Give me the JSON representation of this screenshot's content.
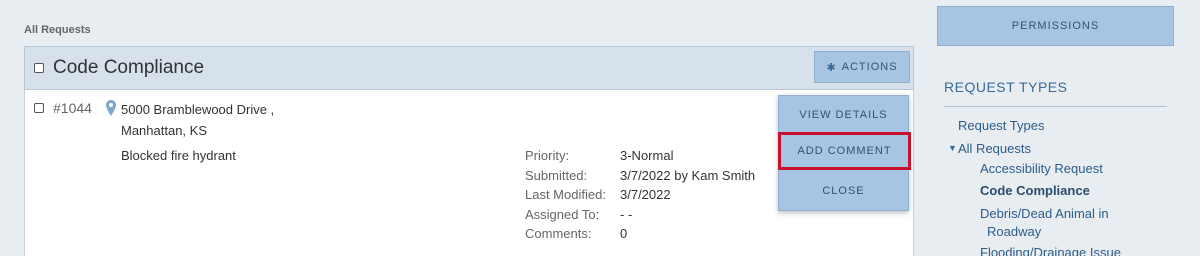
{
  "breadcrumb": "All Requests",
  "group": {
    "title": "Code Compliance",
    "actions_label": "ACTIONS"
  },
  "request": {
    "number": "#1044",
    "address_line1": "5000 Bramblewood Drive ,",
    "address_line2": "Manhattan, KS",
    "description": "Blocked fire hydrant",
    "meta": [
      {
        "label": "Priority:",
        "value": "3-Normal"
      },
      {
        "label": "Submitted:",
        "value": "3/7/2022 by Kam Smith"
      },
      {
        "label": "Last Modified:",
        "value": "3/7/2022"
      },
      {
        "label": "Assigned To:",
        "value": "- -"
      },
      {
        "label": "Comments:",
        "value": "0"
      }
    ]
  },
  "actions_menu": {
    "items": [
      "VIEW DETAILS",
      "ADD COMMENT",
      "CLOSE"
    ],
    "highlighted": "ADD COMMENT"
  },
  "sidebar": {
    "permissions_label": "PERMISSIONS",
    "heading": "REQUEST TYPES",
    "items": [
      "Request Types",
      "All Requests",
      "Accessibility Request",
      "Code Compliance",
      "Debris/Dead Animal in",
      "Roadway",
      "Flooding/Drainage Issue"
    ],
    "current": "Code Compliance"
  },
  "colors": {
    "accent": "#a7c4e2",
    "highlight_border": "#c8102e",
    "link": "#2e5c8a"
  },
  "icons": [
    "gear-icon",
    "location-pin-icon",
    "expand-triangle-icon"
  ]
}
